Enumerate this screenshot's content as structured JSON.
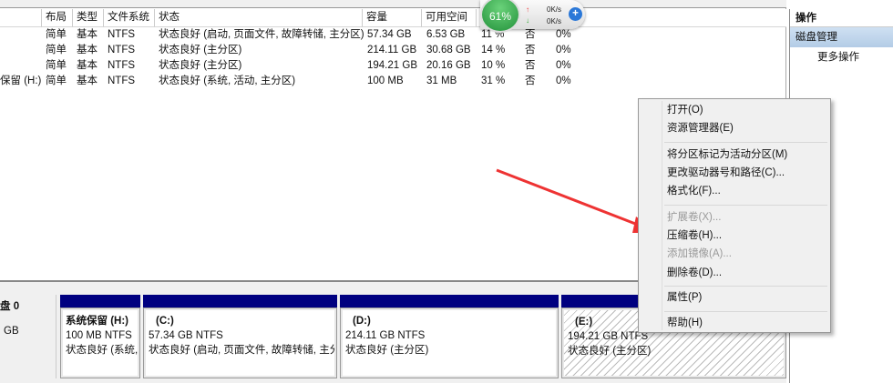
{
  "table": {
    "headers": [
      "布局",
      "类型",
      "文件系统",
      "状态",
      "容量",
      "可用空间"
    ],
    "rows": [
      {
        "name": "",
        "layout": "简单",
        "type": "基本",
        "fs": "NTFS",
        "status": "状态良好 (启动, 页面文件, 故障转储, 主分区)",
        "capacity": "57.34 GB",
        "free": "6.53 GB",
        "pct": "11 %",
        "fault": "否",
        "overhead": "0%"
      },
      {
        "name": "",
        "layout": "简单",
        "type": "基本",
        "fs": "NTFS",
        "status": "状态良好 (主分区)",
        "capacity": "214.11 GB",
        "free": "30.68 GB",
        "pct": "14 %",
        "fault": "否",
        "overhead": "0%"
      },
      {
        "name": "",
        "layout": "简单",
        "type": "基本",
        "fs": "NTFS",
        "status": "状态良好 (主分区)",
        "capacity": "194.21 GB",
        "free": "20.16 GB",
        "pct": "10 %",
        "fault": "否",
        "overhead": "0%"
      },
      {
        "name": "保留 (H:)",
        "layout": "简单",
        "type": "基本",
        "fs": "NTFS",
        "status": "状态良好 (系统, 活动, 主分区)",
        "capacity": "100 MB",
        "free": "31 MB",
        "pct": "31 %",
        "fault": "否",
        "overhead": "0%"
      }
    ]
  },
  "widget": {
    "percent": "61%",
    "up": "0K/s",
    "down": "0K/s"
  },
  "actions": {
    "title": "操作",
    "selected": "磁盘管理",
    "more": "更多操作"
  },
  "disk": {
    "label": "盘 0",
    "size": "GB",
    "partitions": [
      {
        "name": "系统保留  (H:)",
        "size": "100 MB NTFS",
        "status": "状态良好 (系统,"
      },
      {
        "name": "(C:)",
        "size": "57.34 GB NTFS",
        "status": "状态良好 (启动, 页面文件, 故障转储, 主分"
      },
      {
        "name": "(D:)",
        "size": "214.11 GB NTFS",
        "status": "状态良好 (主分区)"
      },
      {
        "name": "(E:)",
        "size": "194.21 GB NTFS",
        "status": "状态良好 (主分区)"
      }
    ]
  },
  "menu": {
    "items": [
      "打开(O)",
      "资源管理器(E)",
      "将分区标记为活动分区(M)",
      "更改驱动器号和路径(C)...",
      "格式化(F)...",
      "扩展卷(X)...",
      "压缩卷(H)...",
      "添加镜像(A)...",
      "删除卷(D)...",
      "属性(P)",
      "帮助(H)"
    ]
  }
}
